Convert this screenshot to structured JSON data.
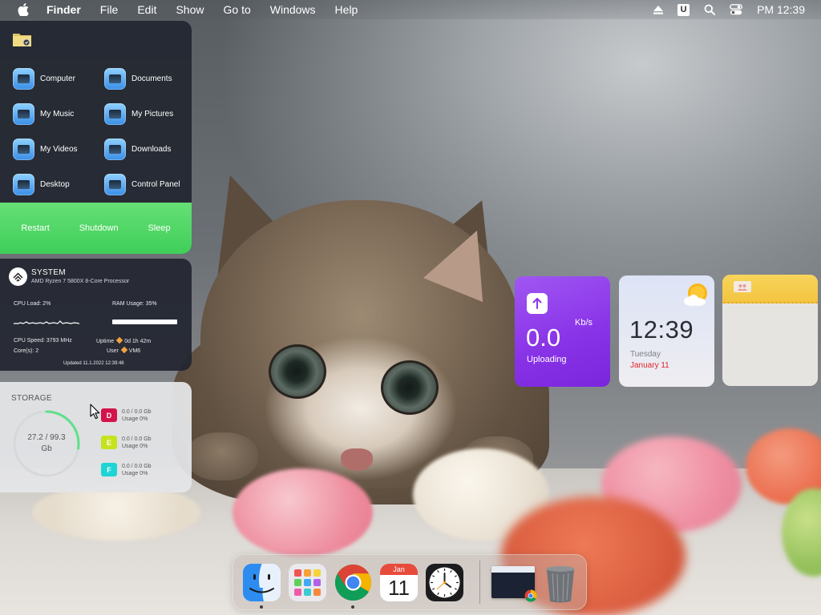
{
  "menubar": {
    "app_name": "Finder",
    "menus": [
      "File",
      "Edit",
      "Show",
      "Go to",
      "Windows",
      "Help"
    ],
    "status_icons": [
      "eject-icon",
      "u-badge-icon",
      "search-icon",
      "control-center-icon"
    ],
    "u_badge": "U",
    "clock": "PM 12:39"
  },
  "quick_access": {
    "items": [
      {
        "label": "Computer",
        "icon": "computer-icon"
      },
      {
        "label": "Documents",
        "icon": "documents-icon"
      },
      {
        "label": "My Music",
        "icon": "music-icon"
      },
      {
        "label": "My Pictures",
        "icon": "pictures-icon"
      },
      {
        "label": "My Videos",
        "icon": "videos-icon"
      },
      {
        "label": "Downloads",
        "icon": "downloads-icon"
      },
      {
        "label": "Desktop",
        "icon": "desktop-icon"
      },
      {
        "label": "Control Panel",
        "icon": "control-panel-icon"
      }
    ],
    "power": {
      "restart": "Restart",
      "shutdown": "Shutdown",
      "sleep": "Sleep"
    },
    "accent": "#4cd466"
  },
  "system": {
    "title": "SYSTEM",
    "cpu_name": "AMD Ryzen 7 5800X 8-Core Processor",
    "cpu_load": "CPU Load: 2%",
    "ram_usage": "RAM Usage: 35%",
    "ram_fraction": 1.0,
    "cpu_speed": "CPU Speed: 3793 MHz",
    "cores": "Core(s): 2",
    "uptime_label": "Uptime",
    "uptime_value": "0d 1h 42m",
    "user_label": "User",
    "user_value": "VM6",
    "updated": "Updated 11.1.2022 12:39:48"
  },
  "storage": {
    "title": "STORAGE",
    "total_text": "27.2 / 99.3",
    "unit": "Gb",
    "used_fraction": 0.274,
    "ring_color": "#5fe08a",
    "drives": [
      {
        "letter": "D",
        "line1": "0.0 / 0.0 Gb",
        "line2": "Usage 0%",
        "color": "#d3134b"
      },
      {
        "letter": "E",
        "line1": "0.0 / 0.0 Gb",
        "line2": "Usage 0%",
        "color": "#c6e21d"
      },
      {
        "letter": "F",
        "line1": "0.0 / 0.0 Gb",
        "line2": "Usage 0%",
        "color": "#1fd4d4"
      }
    ]
  },
  "upload": {
    "unit": "Kb/s",
    "value": "0.0",
    "label": "Uploading",
    "color": "#8b36e9"
  },
  "clock_widget": {
    "time": "12:39",
    "day": "Tuesday",
    "date": "January 11",
    "weather_icon": "partly-sunny-icon"
  },
  "notes_widget": {
    "icon": "people-icon",
    "color": "#f4c942"
  },
  "dock": {
    "apps": [
      {
        "name": "Finder",
        "icon": "finder-icon",
        "running": true
      },
      {
        "name": "Launchpad",
        "icon": "launchpad-icon",
        "running": false
      },
      {
        "name": "Google Chrome",
        "icon": "chrome-icon",
        "running": true
      },
      {
        "name": "Calendar",
        "icon": "calendar-icon",
        "running": false
      },
      {
        "name": "Clock",
        "icon": "clock-icon",
        "running": false
      }
    ],
    "calendar_month": "Jan",
    "calendar_day": "11",
    "minimized_window": "chrome-window-thumbnail",
    "trash": "trash-icon"
  }
}
